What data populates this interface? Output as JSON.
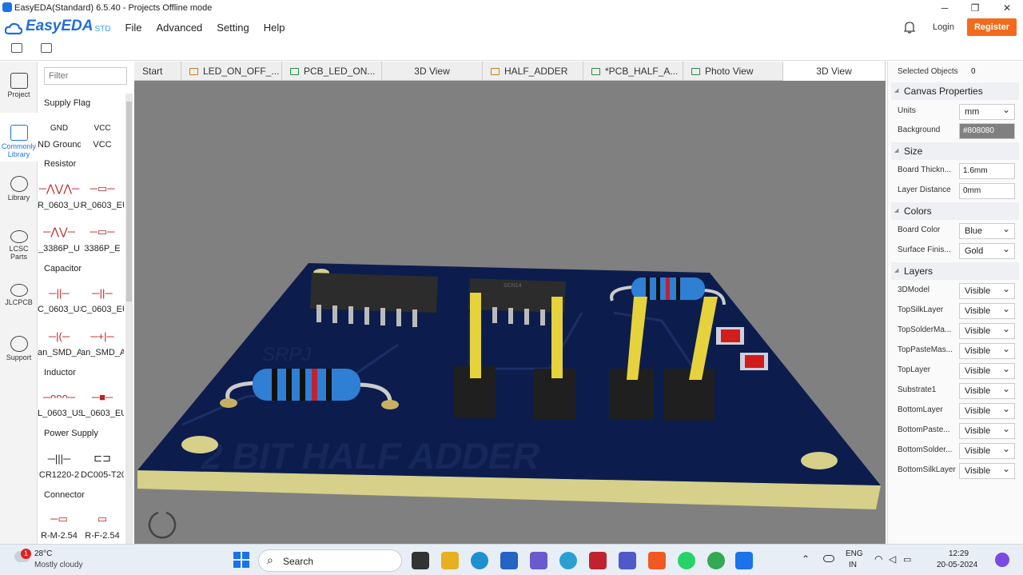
{
  "window": {
    "title": "EasyEDA(Standard) 6.5.40 - Projects Offline mode",
    "min": "─",
    "restore": "❐",
    "close": "✕"
  },
  "brand": {
    "name": "EasyEDA",
    "std": "STD"
  },
  "menu": [
    "File",
    "Advanced",
    "Setting",
    "Help"
  ],
  "account": {
    "login": "Login",
    "register": "Register"
  },
  "leftnav": [
    {
      "label": "Project",
      "icon": "folder-icon"
    },
    {
      "label": "Commonly Library",
      "icon": "chip-icon"
    },
    {
      "label": "Library",
      "icon": "library-icon"
    },
    {
      "label": "LCSC Parts",
      "icon": "lcsc-icon"
    },
    {
      "label": "JLCPCB",
      "icon": "jlc-icon"
    },
    {
      "label": "Support",
      "icon": "help-icon"
    }
  ],
  "library": {
    "filter_placeholder": "Filter",
    "sections": {
      "supply_flag": "Supply Flag",
      "resistor": "Resistor",
      "capacitor": "Capacitor",
      "inductor": "Inductor",
      "power_supply": "Power Supply",
      "connector": "Connector"
    },
    "items": {
      "gnd": "ND Ground",
      "gnd_sym": "GND",
      "vcc": "VCC",
      "vcc_sym": "VCC",
      "r_us": "R_0603_US",
      "r_eu": "R_0603_EU",
      "pot_us": "_3386P_U",
      "pot_eu": "3386P_E",
      "c_us": "C_0603_US",
      "c_eu": "C_0603_EU",
      "csmd_a": "an_SMD_A",
      "csmd_b": "an_SMD_A",
      "l_us": "L_0603_US",
      "l_eu": "L_0603_EU",
      "bat": "CR1220-2",
      "dc": "DC005-T20",
      "conn_m": "R-M-2.54",
      "conn_f": "R-F-2.54"
    }
  },
  "tabs": [
    {
      "label": "Start",
      "icon": ""
    },
    {
      "label": "LED_ON_OFF_...",
      "icon": "folder"
    },
    {
      "label": "PCB_LED_ON...",
      "icon": "pcb"
    },
    {
      "label": "3D View",
      "icon": ""
    },
    {
      "label": "HALF_ADDER",
      "icon": "folder"
    },
    {
      "label": "*PCB_HALF_A...",
      "icon": "pcb"
    },
    {
      "label": "Photo View",
      "icon": "pcb"
    },
    {
      "label": "3D View",
      "icon": "",
      "active": true
    }
  ],
  "board": {
    "silk_text": "2 BIT HALF ADDER",
    "silk_watermark": "SRPJ",
    "ic_marking": "SCN14"
  },
  "props": {
    "selected_label": "Selected Objects",
    "selected_count": "0",
    "canvas_header": "Canvas Properties",
    "units_label": "Units",
    "units_value": "mm",
    "background_label": "Background",
    "background_value": "#808080",
    "size_header": "Size",
    "thick_label": "Board Thickn...",
    "thick_value": "1.6mm",
    "layerdist_label": "Layer Distance",
    "layerdist_value": "0mm",
    "colors_header": "Colors",
    "boardcolor_label": "Board Color",
    "boardcolor_value": "Blue",
    "finish_label": "Surface Finis...",
    "finish_value": "Gold",
    "layers_header": "Layers",
    "layers": [
      {
        "name": "3DModel",
        "value": "Visible"
      },
      {
        "name": "TopSilkLayer",
        "value": "Visible"
      },
      {
        "name": "TopSolderMa...",
        "value": "Visible"
      },
      {
        "name": "TopPasteMas...",
        "value": "Visible"
      },
      {
        "name": "TopLayer",
        "value": "Visible"
      },
      {
        "name": "Substrate1",
        "value": "Visible"
      },
      {
        "name": "BottomLayer",
        "value": "Visible"
      },
      {
        "name": "BottomPaste...",
        "value": "Visible"
      },
      {
        "name": "BottomSolder...",
        "value": "Visible"
      },
      {
        "name": "BottomSilkLayer",
        "value": "Visible"
      }
    ]
  },
  "taskbar": {
    "temp": "28°C",
    "weather": "Mostly cloudy",
    "badge": "1",
    "search": "Search",
    "lang1": "ENG",
    "lang2": "IN",
    "time": "12:29",
    "date": "20-05-2024"
  },
  "colors": {
    "accent": "#1a73e8",
    "register": "#f26b1d",
    "canvas": "#808080",
    "pcb": "#0b1f4a"
  }
}
